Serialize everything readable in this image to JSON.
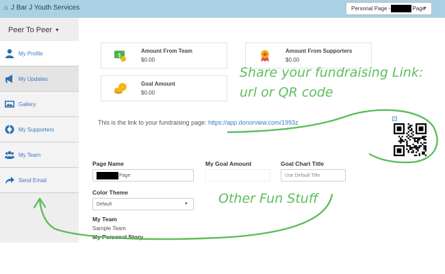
{
  "topbar": {
    "brand": "J Bar J Youth Services",
    "home_icon": "home-icon",
    "page_select": {
      "prefix": "Personal Page - ",
      "suffix": "Page"
    }
  },
  "left": {
    "title": "Peer To Peer",
    "nav": [
      {
        "label": "My Profile",
        "icon": "user-icon"
      },
      {
        "label": "My Updates",
        "icon": "megaphone-icon"
      },
      {
        "label": "Gallery",
        "icon": "image-icon"
      },
      {
        "label": "My Supporters",
        "icon": "lifebuoy-icon"
      },
      {
        "label": "My Team",
        "icon": "group-icon"
      },
      {
        "label": "Send Email",
        "icon": "share-icon"
      }
    ]
  },
  "stats": {
    "from_team": {
      "label": "Amount From Team",
      "value": "$0.00",
      "icon": "money-icon"
    },
    "from_supporters": {
      "label": "Amount From Supporters",
      "value": "$0.00",
      "icon": "award-icon"
    },
    "goal": {
      "label": "Goal Amount",
      "value": "$0.00",
      "icon": "coins-icon"
    }
  },
  "annotations": {
    "share_line1": "Share your fundraising Link:",
    "share_line2": "url or QR code",
    "other": "Other Fun Stuff"
  },
  "link": {
    "prefix": "This is the link to your fundraising page: ",
    "url": "https://app.donorview.com/1993z"
  },
  "form": {
    "page_name_label": "Page Name",
    "page_name_value": "Page",
    "goal_amount_label": "My Goal Amount",
    "goal_chart_label": "Goal Chart Title",
    "goal_chart_placeholder": "Use Default Title",
    "color_theme_label": "Color Theme",
    "color_theme_value": "Default",
    "my_team_label": "My Team",
    "my_team_value": "Sample Team",
    "personal_story_label": "My Personal Story"
  },
  "colors": {
    "topbar": "#a9d0e3",
    "link": "#3a7bbf",
    "annotation": "#5cbe5c"
  }
}
